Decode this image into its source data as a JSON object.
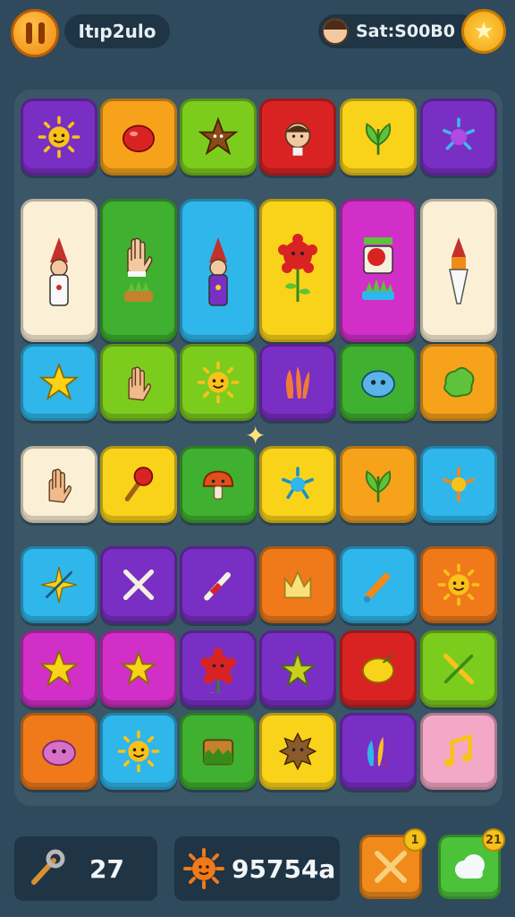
{
  "hud": {
    "level_label": "Itıp2ulo",
    "player_score_label": "Sat:S00B0",
    "moves": "27",
    "score": "95754a",
    "powerup_hammer_count": "1",
    "powerup_cloud_count": "21"
  },
  "colors": {
    "purple": "#7a2fc4",
    "orange": "#f6a21a",
    "lime": "#7ccc1e",
    "red": "#d92323",
    "yellow": "#f9d21a",
    "cyan": "#2fb6ea",
    "green": "#3fb02f",
    "magenta": "#d12fc8",
    "cream": "#fbf0d6",
    "deeporange": "#f07a1a",
    "pink": "#f4a8c8"
  },
  "board": {
    "rows": [
      {
        "tiles": [
          {
            "name": "sun-face-icon",
            "color": "purple"
          },
          {
            "name": "red-blob-icon",
            "color": "orange"
          },
          {
            "name": "brown-star-icon",
            "color": "lime"
          },
          {
            "name": "person-face-icon",
            "color": "red"
          },
          {
            "name": "leaf-icon",
            "color": "yellow"
          },
          {
            "name": "splat-icon",
            "color": "purple"
          }
        ]
      },
      {
        "tall": true,
        "tiles": [
          {
            "name": "gnome-icon",
            "color": "cream"
          },
          {
            "name": "hand-plant-icon",
            "color": "green"
          },
          {
            "name": "gnome-purple-icon",
            "color": "cyan"
          },
          {
            "name": "red-flower-icon",
            "color": "yellow"
          },
          {
            "name": "card-plant-icon",
            "color": "magenta"
          },
          {
            "name": "brush-icon",
            "color": "cream"
          }
        ]
      },
      {
        "tiles": [
          {
            "name": "star-icon",
            "color": "cyan"
          },
          {
            "name": "hand-icon",
            "color": "lime"
          },
          {
            "name": "sun-face-icon",
            "color": "lime"
          },
          {
            "name": "orange-leaf-icon",
            "color": "purple"
          },
          {
            "name": "blue-blob-icon",
            "color": "green"
          },
          {
            "name": "green-blob-icon",
            "color": "orange"
          }
        ]
      },
      {
        "tiles": [
          {
            "name": "hand-icon",
            "color": "cream"
          },
          {
            "name": "torch-icon",
            "color": "yellow"
          },
          {
            "name": "mushroom-icon",
            "color": "green"
          },
          {
            "name": "blue-splat-icon",
            "color": "yellow"
          },
          {
            "name": "leaf-icon",
            "color": "orange"
          },
          {
            "name": "yellow-splat-icon",
            "color": "cyan"
          }
        ]
      },
      {
        "tiles": [
          {
            "name": "sparkle-icon",
            "color": "cyan"
          },
          {
            "name": "cross-icon",
            "color": "purple"
          },
          {
            "name": "pen-icon",
            "color": "purple"
          },
          {
            "name": "crown-icon",
            "color": "deeporange"
          },
          {
            "name": "bottle-icon",
            "color": "cyan"
          },
          {
            "name": "sun-face-icon",
            "color": "deeporange"
          }
        ]
      },
      {
        "tiles": [
          {
            "name": "star-icon",
            "color": "magenta"
          },
          {
            "name": "star-half-icon",
            "color": "magenta"
          },
          {
            "name": "red-flower-icon",
            "color": "purple"
          },
          {
            "name": "leaf-star-icon",
            "color": "purple"
          },
          {
            "name": "lemon-icon",
            "color": "red"
          },
          {
            "name": "crossed-sticks-icon",
            "color": "lime"
          }
        ]
      },
      {
        "tiles": [
          {
            "name": "pink-blob-icon",
            "color": "deeporange"
          },
          {
            "name": "sun-face-icon",
            "color": "cyan"
          },
          {
            "name": "grass-card-icon",
            "color": "green"
          },
          {
            "name": "brown-sun-icon",
            "color": "yellow"
          },
          {
            "name": "feather-icon",
            "color": "purple"
          },
          {
            "name": "music-note-icon",
            "color": "pink"
          }
        ]
      }
    ]
  }
}
